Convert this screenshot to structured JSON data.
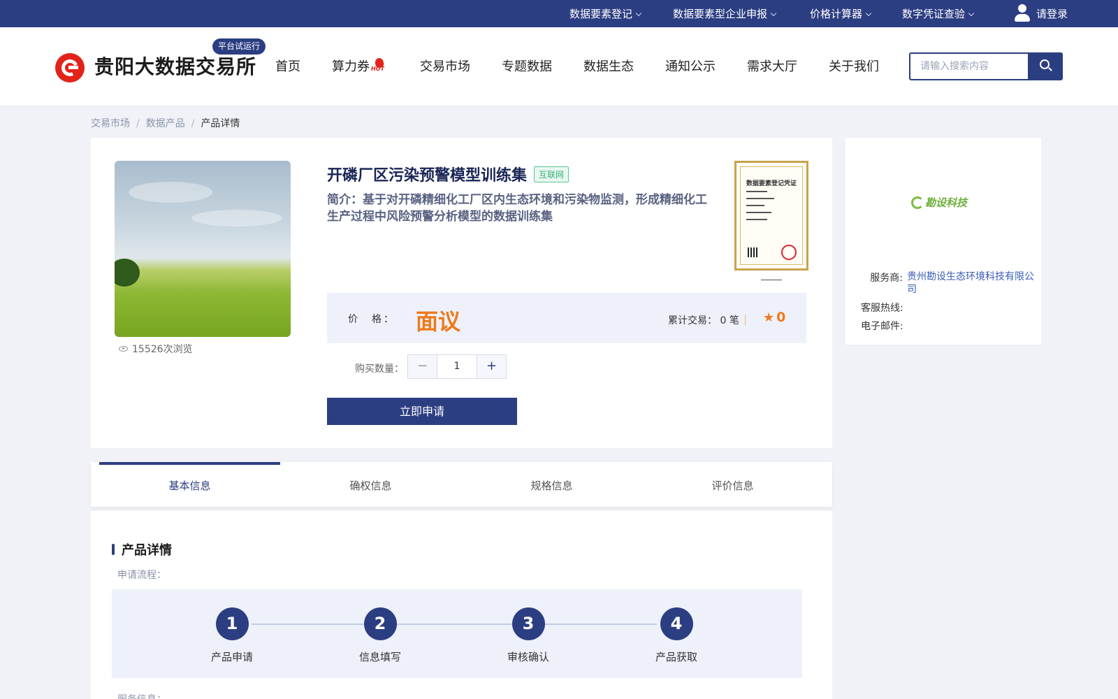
{
  "topbar": {
    "items": [
      {
        "label": "数据要素登记"
      },
      {
        "label": "数据要素型企业申报"
      },
      {
        "label": "价格计算器"
      },
      {
        "label": "数字凭证查验"
      }
    ],
    "login_label": "请登录"
  },
  "header": {
    "logo_text": "贵阳大数据交易所",
    "trial_badge": "平台试运行",
    "nav": [
      {
        "label": "首页"
      },
      {
        "label": "算力券"
      },
      {
        "label": "交易市场"
      },
      {
        "label": "专题数据"
      },
      {
        "label": "数据生态"
      },
      {
        "label": "通知公示"
      },
      {
        "label": "需求大厅"
      },
      {
        "label": "关于我们"
      }
    ],
    "hot_badge": "HOT",
    "search_placeholder": "请输入搜索内容"
  },
  "breadcrumb": {
    "items": [
      "交易市场",
      "数据产品",
      "产品详情"
    ]
  },
  "product": {
    "title": "开磷厂区污染预警模型训练集",
    "tag": "互联网",
    "description": "简介：基于对开磷精细化工厂区内生态环境和污染物监测，形成精细化工生产过程中风险预警分析模型的数据训练集",
    "views": "15526次浏览",
    "certificate_title": "数据要素登记凭证",
    "price_label": "价　格：",
    "price": "面议",
    "trade_label": "累计交易：",
    "trade_count": "0",
    "trade_unit": "笔",
    "rating": "0",
    "qty_label": "购买数量：",
    "qty": "1",
    "apply_label": "立即申请"
  },
  "provider": {
    "logo_text": "勘设科技",
    "service_label": "服务商:",
    "service_value": "贵州勘设生态环境科技有限公司",
    "hotline_label": "客服热线:",
    "email_label": "电子邮件:"
  },
  "tabs": [
    {
      "label": "基本信息",
      "active": true
    },
    {
      "label": "确权信息",
      "active": false
    },
    {
      "label": "规格信息",
      "active": false
    },
    {
      "label": "评价信息",
      "active": false
    }
  ],
  "details": {
    "section_title": "产品详情",
    "flow_label": "申请流程：",
    "steps": [
      {
        "num": "1",
        "label": "产品申请"
      },
      {
        "num": "2",
        "label": "信息填写"
      },
      {
        "num": "3",
        "label": "审核确认"
      },
      {
        "num": "4",
        "label": "产品获取"
      }
    ],
    "service_info_label": "服务信息："
  },
  "colors": {
    "primary": "#2c3e82",
    "price": "#ee7a1b",
    "logo_red": "#e2231a",
    "tag_green": "#3ab07a"
  }
}
